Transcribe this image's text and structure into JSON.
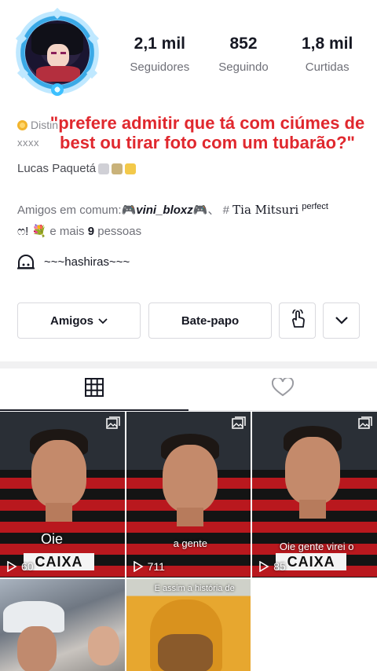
{
  "profile": {
    "stats": [
      {
        "value": "2,1 mil",
        "label": "Seguidores"
      },
      {
        "value": "852",
        "label": "Seguindo"
      },
      {
        "value": "1,8 mil",
        "label": "Curtidas"
      }
    ],
    "bio_line1": "Distin",
    "bio_line2": "xxxx",
    "bio_line3": "Lucas Paquetá",
    "overlay_quote": "\"prefere admitir que tá com ciúmes de best ou tirar foto com um tubarão?\"",
    "mutual_prefix": "Amigos em comum:",
    "mutual_friend_1": "vini_bloxz",
    "mutual_sep": "、 #",
    "mutual_friend_2": "Tia Mitsuri",
    "mutual_friend_2_sup": "perfect",
    "mutual_line2_start": "ෆ!",
    "mutual_more_prefix": "e mais",
    "mutual_more_count": "9",
    "mutual_more_suffix": "pessoas",
    "group_name": "~~~hashiras~~~"
  },
  "actions": {
    "friends_label": "Amigos",
    "chat_label": "Bate-papo"
  },
  "tabs": [
    {
      "icon": "grid-icon",
      "active": true
    },
    {
      "icon": "heart-outline-icon",
      "active": false
    }
  ],
  "videos": [
    {
      "views": "60",
      "caption": "Oie",
      "photo_badge": true
    },
    {
      "views": "711",
      "caption": "a gente",
      "photo_badge": true
    },
    {
      "views": "85",
      "caption": "Oie gente virei o Paquetá",
      "photo_badge": true
    },
    {
      "views": "",
      "caption": "",
      "photo_badge": false
    },
    {
      "views": "",
      "caption": "E assim a história de",
      "photo_badge": false
    }
  ],
  "colors": {
    "accent_red": "#e0282e",
    "text_primary": "#161823",
    "text_secondary": "#6f7078"
  }
}
